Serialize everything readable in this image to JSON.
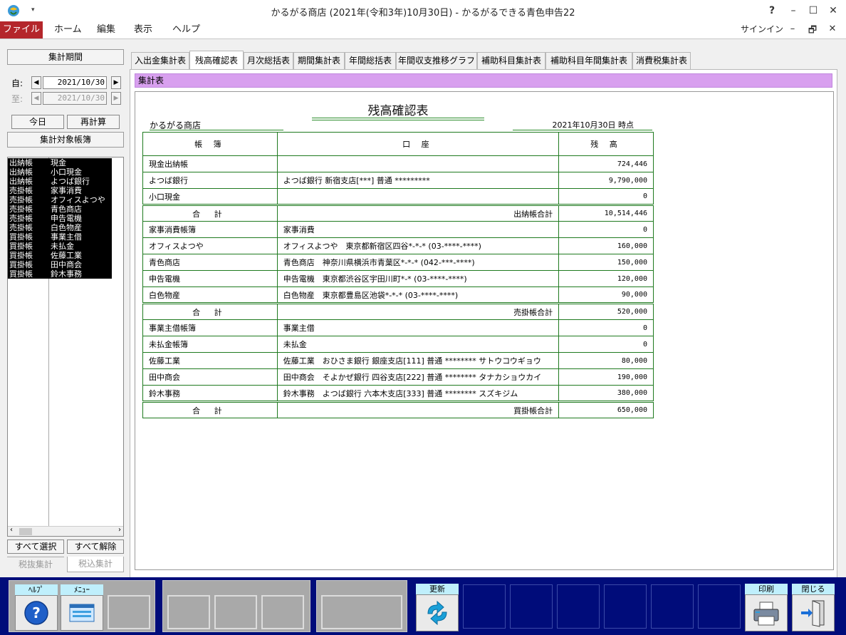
{
  "window": {
    "title": "かるがる商店 (2021年(令和3年)10月30日) - かるがるできる青色申告22",
    "help_glyph": "?",
    "minimize_glyph": "–",
    "maximize_glyph": "☐",
    "close_glyph": "✕"
  },
  "menu": {
    "items": [
      "ファイル",
      "ホーム",
      "編集",
      "表示",
      "ヘルプ"
    ],
    "signin": "サインイン",
    "mdi_min": "–",
    "mdi_restore": "🗗",
    "mdi_close": "✕"
  },
  "left": {
    "period_header": "集計期間",
    "from_label": "自:",
    "to_label": "至:",
    "from_date": "2021/10/30",
    "to_date": "2021/10/30",
    "today_btn": "今日",
    "recalc_btn": "再計算",
    "ledgers_header": "集計対象帳簿",
    "ledgers": [
      {
        "type": "出納帳",
        "name": "現金"
      },
      {
        "type": "出納帳",
        "name": "小口現金"
      },
      {
        "type": "出納帳",
        "name": "よつば銀行"
      },
      {
        "type": "売掛帳",
        "name": "家事消費"
      },
      {
        "type": "売掛帳",
        "name": "オフィスよつや"
      },
      {
        "type": "売掛帳",
        "name": "青色商店"
      },
      {
        "type": "売掛帳",
        "name": "申告電機"
      },
      {
        "type": "売掛帳",
        "name": "白色物産"
      },
      {
        "type": "買掛帳",
        "name": "事業主借"
      },
      {
        "type": "買掛帳",
        "name": "未払金"
      },
      {
        "type": "買掛帳",
        "name": "佐藤工業"
      },
      {
        "type": "買掛帳",
        "name": "田中商会"
      },
      {
        "type": "買掛帳",
        "name": "鈴木事務"
      }
    ],
    "select_all": "すべて選択",
    "deselect_all": "すべて解除",
    "tax_excl": "税抜集計",
    "tax_incl": "税込集計"
  },
  "tabs": [
    "入出金集計表",
    "残高確認表",
    "月次総括表",
    "期間集計表",
    "年間総括表",
    "年間収支推移グラフ",
    "補助科目集計表",
    "補助科目年間集計表",
    "消費税集計表"
  ],
  "active_tab": "残高確認表",
  "band_label": "集計表",
  "report": {
    "title": "残高確認表",
    "shop": "かるがる商店",
    "as_of": "2021年10月30日 時点",
    "headers": [
      "帳 簿",
      "口 座",
      "残 高"
    ],
    "rows": [
      {
        "ledger": "現金出納帳",
        "account": "",
        "balance": "724,446"
      },
      {
        "ledger": "よつば銀行",
        "account": "よつば銀行 新宿支店[***] 普通 *********",
        "balance": "9,790,000"
      },
      {
        "ledger": "小口現金",
        "account": "",
        "balance": "0"
      },
      {
        "ledger": "合 計",
        "account": "出納帳合計",
        "balance": "10,514,446",
        "total": true
      },
      {
        "ledger": "家事消費帳簿",
        "account": "家事消費",
        "balance": "0"
      },
      {
        "ledger": "オフィスよつや",
        "account": "オフィスよつや　東京都新宿区四谷*-*-* (03-****-****)",
        "balance": "160,000"
      },
      {
        "ledger": "青色商店",
        "account": "青色商店　神奈川県横浜市青葉区*-*-* (042-***-****)",
        "balance": "150,000"
      },
      {
        "ledger": "申告電機",
        "account": "申告電機　東京都渋谷区宇田川町*-* (03-****-****)",
        "balance": "120,000"
      },
      {
        "ledger": "白色物産",
        "account": "白色物産　東京都豊島区池袋*-*-* (03-****-****)",
        "balance": "90,000"
      },
      {
        "ledger": "合 計",
        "account": "売掛帳合計",
        "balance": "520,000",
        "total": true
      },
      {
        "ledger": "事業主借帳簿",
        "account": "事業主借",
        "balance": "0"
      },
      {
        "ledger": "未払金帳簿",
        "account": "未払金",
        "balance": "0"
      },
      {
        "ledger": "佐藤工業",
        "account": "佐藤工業　おひさま銀行 銀座支店[111] 普通 ******** サトウコウギョウ",
        "balance": "80,000"
      },
      {
        "ledger": "田中商会",
        "account": "田中商会　そよかぜ銀行 四谷支店[222] 普通 ******** タナカショウカイ",
        "balance": "190,000"
      },
      {
        "ledger": "鈴木事務",
        "account": "鈴木事務　よつば銀行 六本木支店[333] 普通 ******** スズキジム",
        "balance": "380,000"
      },
      {
        "ledger": "合 計",
        "account": "買掛帳合計",
        "balance": "650,000",
        "total": true
      }
    ]
  },
  "toolbar": {
    "help": "ﾍﾙﾌﾟ",
    "menu": "ﾒﾆｭｰ",
    "refresh": "更新",
    "print": "印刷",
    "close": "閉じる",
    "colors": {
      "bg": "#000c7a",
      "label": "#bfeffc",
      "accent": "#b4262b",
      "band": "#d8a0ef"
    }
  }
}
